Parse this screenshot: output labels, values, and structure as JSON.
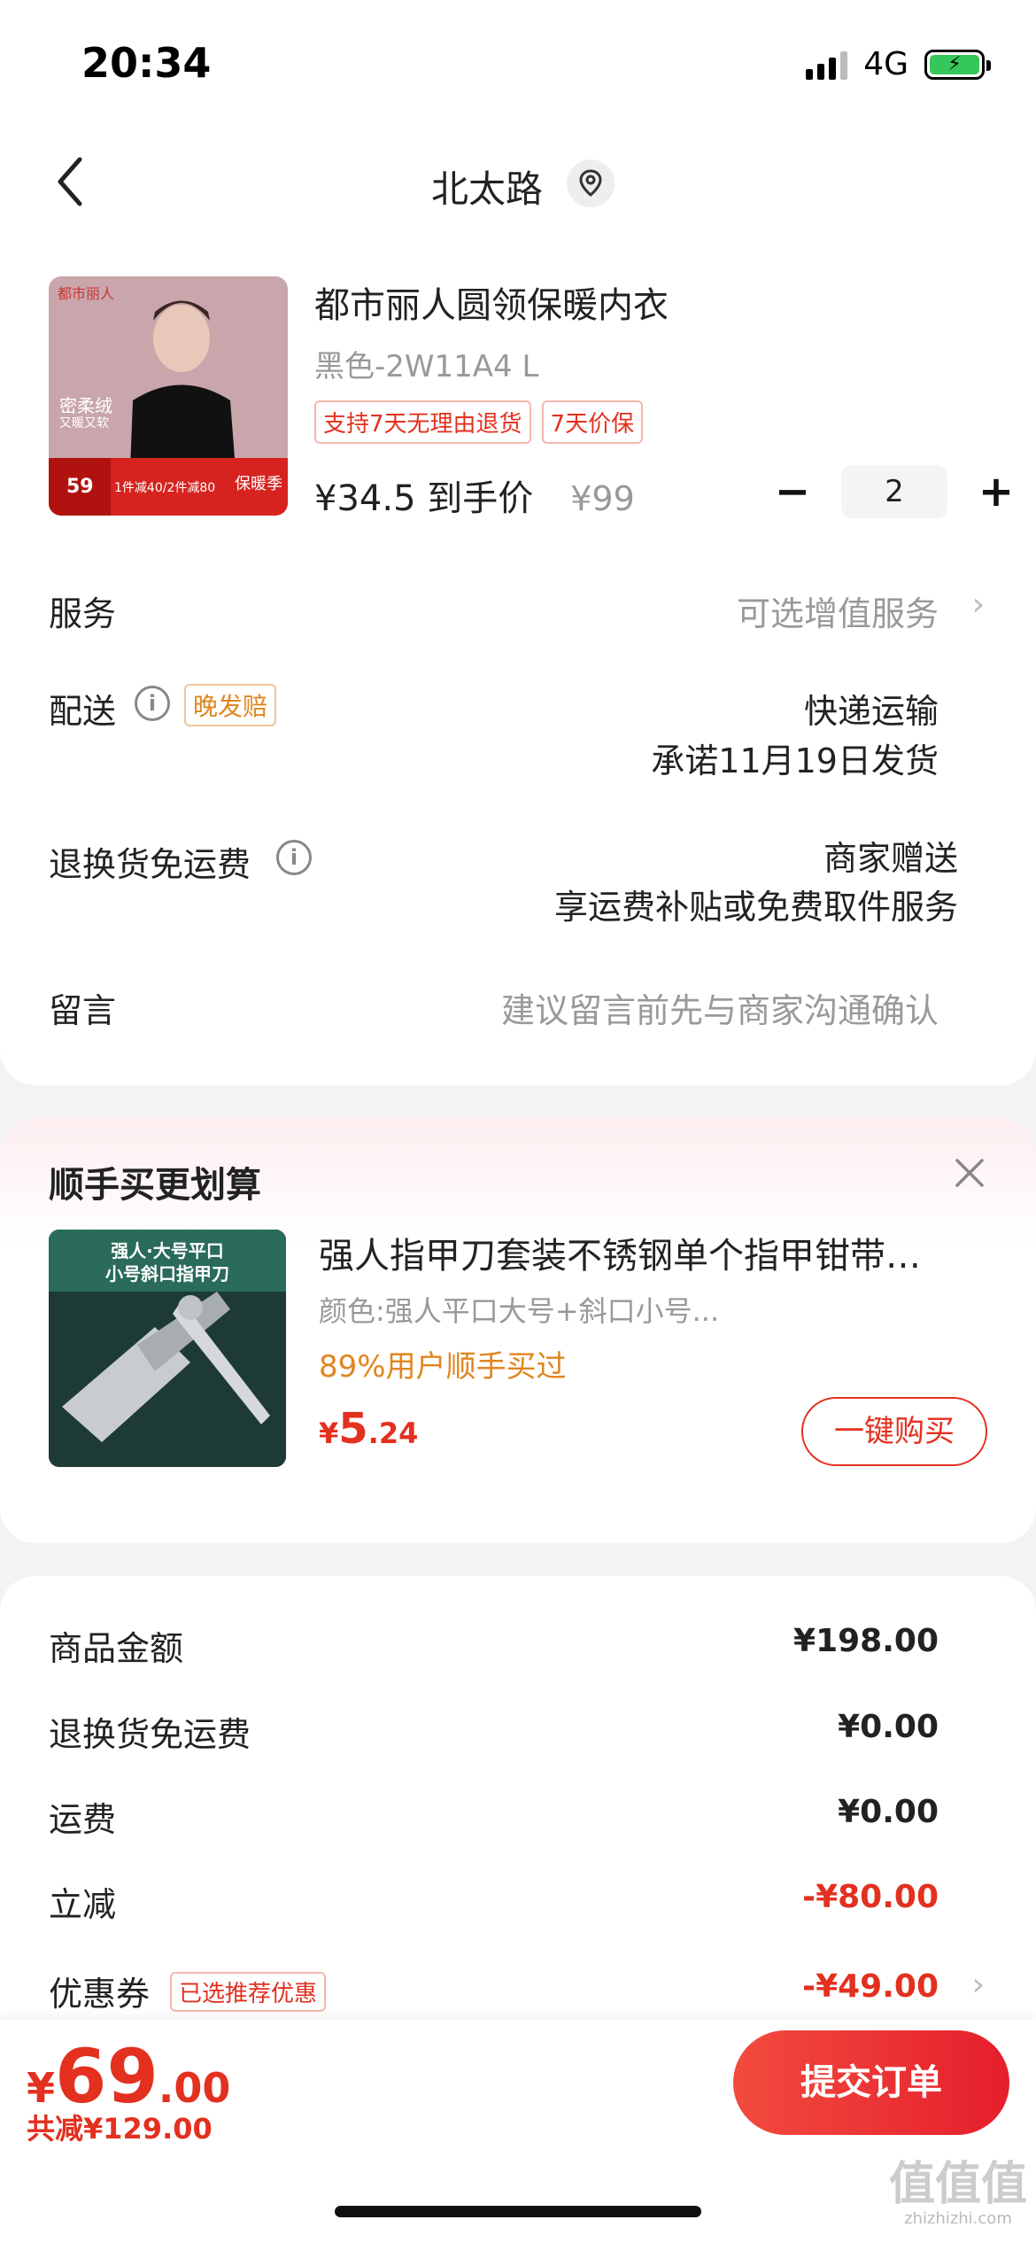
{
  "status_bar": {
    "time": "20:34",
    "network": "4G"
  },
  "header": {
    "title": "北太路"
  },
  "product": {
    "name": "都市丽人圆领保暖内衣",
    "sku": "黑色-2W11A4 L",
    "tags": [
      "支持7天无理由退货",
      "7天价保"
    ],
    "price": "¥34.5 到手价",
    "original_price": "¥99",
    "quantity": "2",
    "image_text": {
      "brand": "都市丽人",
      "feature": "密柔绒",
      "feature_sub": "又暖又软",
      "promo": "1件减40/2件减80",
      "promo_price": "59",
      "season": "保暖季"
    }
  },
  "rows": {
    "service_label": "服务",
    "service_value": "可选增值服务",
    "delivery_label": "配送",
    "delivery_tag": "晚发赔",
    "delivery_method": "快递运输",
    "delivery_promise": "承诺11月19日发货",
    "return_label": "退换货免运费",
    "return_value": "商家赠送",
    "return_desc": "享运费补贴或免费取件服务",
    "message_label": "留言",
    "message_placeholder": "建议留言前先与商家沟通确认"
  },
  "addon": {
    "title": "顺手买更划算",
    "name": "强人指甲刀套装不锈钢单个指甲钳带…",
    "sku": "颜色:强人平口大号+斜口小号...",
    "percent": "89%用户顺手买过",
    "price_int": "5",
    "price_dec": ".24",
    "buy_label": "一键购买",
    "image_text_1": "强人·大号平口",
    "image_text_2": "小号斜口指甲刀"
  },
  "summary": {
    "goods_label": "商品金额",
    "goods_value": "¥198.00",
    "return_fee_label": "退换货免运费",
    "return_fee_value": "¥0.00",
    "shipping_label": "运费",
    "shipping_value": "¥0.00",
    "discount_label": "立减",
    "discount_value": "-¥80.00",
    "coupon_label": "优惠券",
    "coupon_tag": "已选推荐优惠",
    "coupon_value": "-¥49.00"
  },
  "footer": {
    "total_int": "69",
    "total_dec": ".00",
    "saved": "共减¥129.00",
    "submit_label": "提交订单"
  },
  "colors": {
    "accent": "#e3301f",
    "orange": "#e08520"
  }
}
